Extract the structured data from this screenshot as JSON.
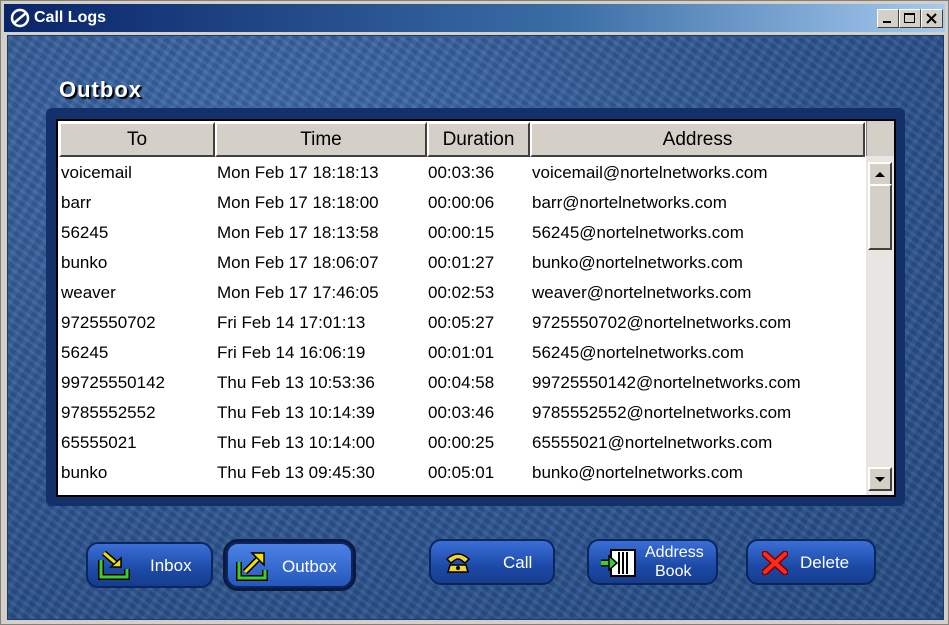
{
  "window": {
    "title": "Call Logs"
  },
  "section": {
    "title": "Outbox"
  },
  "table": {
    "columns": [
      "To",
      "Time",
      "Duration",
      "Address"
    ],
    "rows": [
      [
        "voicemail",
        "Mon Feb 17 18:18:13",
        "00:03:36",
        "voicemail@nortelnetworks.com"
      ],
      [
        "barr",
        "Mon Feb 17 18:18:00",
        "00:00:06",
        "barr@nortelnetworks.com"
      ],
      [
        "56245",
        "Mon Feb 17 18:13:58",
        "00:00:15",
        "56245@nortelnetworks.com"
      ],
      [
        "bunko",
        "Mon Feb 17 18:06:07",
        "00:01:27",
        "bunko@nortelnetworks.com"
      ],
      [
        "weaver",
        "Mon Feb 17 17:46:05",
        "00:02:53",
        "weaver@nortelnetworks.com"
      ],
      [
        "9725550702",
        "Fri Feb 14 17:01:13",
        "00:05:27",
        "9725550702@nortelnetworks.com"
      ],
      [
        "56245",
        "Fri Feb 14 16:06:19",
        "00:01:01",
        "56245@nortelnetworks.com"
      ],
      [
        "99725550142",
        "Thu Feb 13 10:53:36",
        "00:04:58",
        "99725550142@nortelnetworks.com"
      ],
      [
        "9785552552",
        "Thu Feb 13 10:14:39",
        "00:03:46",
        "9785552552@nortelnetworks.com"
      ],
      [
        "65555021",
        "Thu Feb 13 10:14:00",
        "00:00:25",
        "65555021@nortelnetworks.com"
      ],
      [
        "bunko",
        "Thu Feb 13 09:45:30",
        "00:05:01",
        "bunko@nortelnetworks.com"
      ]
    ]
  },
  "buttons": {
    "inbox": "Inbox",
    "outbox": "Outbox",
    "call": "Call",
    "address_book_line1": "Address",
    "address_book_line2": "Book",
    "delete": "Delete"
  },
  "colors": {
    "accent": "#2d5591",
    "titlebar": "#0a246a"
  },
  "icons": [
    "app-logo-icon",
    "minimize-icon",
    "maximize-icon",
    "close-icon",
    "scroll-up-icon",
    "scroll-down-icon",
    "inbox-arrow-icon",
    "outbox-arrow-icon",
    "phone-icon",
    "address-book-icon",
    "delete-x-icon"
  ]
}
